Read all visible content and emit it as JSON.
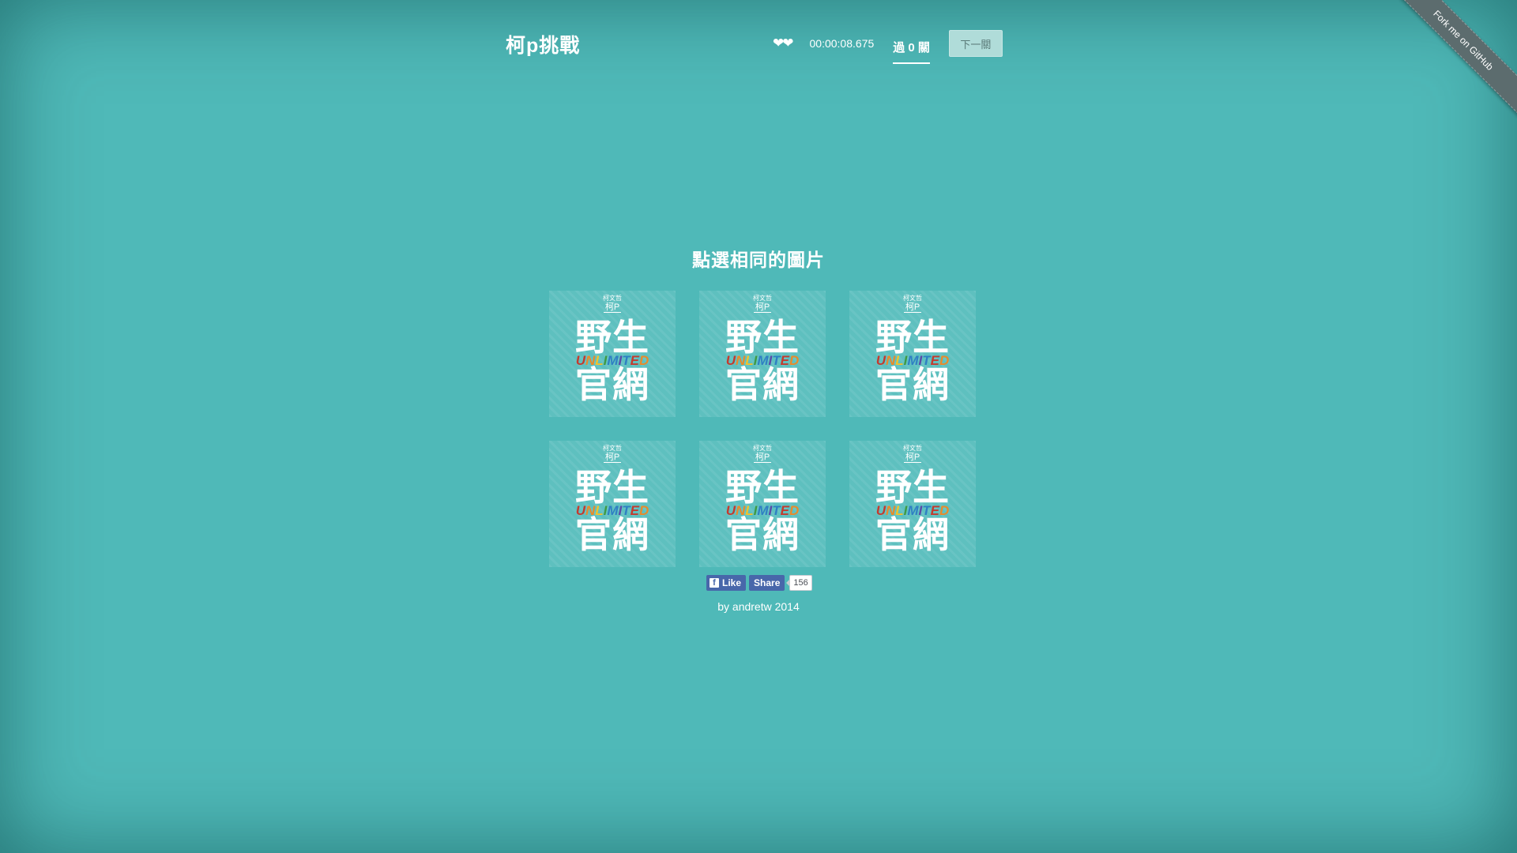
{
  "navbar": {
    "brand": "柯p挑戰",
    "lives": "❤❤",
    "timer": "00:00:08.675",
    "level": "過 0 關",
    "next_button": "下一關"
  },
  "ribbon": {
    "label": "Fork me on GitHub"
  },
  "main": {
    "instruction": "點選相同的圖片",
    "cards": [
      {
        "small": "柯文哲",
        "mark": "柯P",
        "top": "野生",
        "bottom": "官網",
        "stripe": "UNLIMITED"
      },
      {
        "small": "柯文哲",
        "mark": "柯P",
        "top": "野生",
        "bottom": "官網",
        "stripe": "UNLIMITED"
      },
      {
        "small": "柯文哲",
        "mark": "柯P",
        "top": "野生",
        "bottom": "官網",
        "stripe": "UNLIMITED"
      },
      {
        "small": "柯文哲",
        "mark": "柯P",
        "top": "野生",
        "bottom": "官網",
        "stripe": "UNLIMITED"
      },
      {
        "small": "柯文哲",
        "mark": "柯P",
        "top": "野生",
        "bottom": "官網",
        "stripe": "UNLIMITED"
      },
      {
        "small": "柯文哲",
        "mark": "柯P",
        "top": "野生",
        "bottom": "官網",
        "stripe": "UNLIMITED"
      }
    ],
    "stripe_colors": [
      "#c43a2f",
      "#e98a2a",
      "#f2c22c",
      "#3f9a45",
      "#2f7fc4",
      "#5b4aa8",
      "#2f7fc4",
      "#c43a2f",
      "#e98a2a"
    ]
  },
  "social": {
    "like_label": "Like",
    "share_label": "Share",
    "count": "156"
  },
  "footer": {
    "credit": "by andretw 2014"
  },
  "colors": {
    "background": "#4fb9b8",
    "facebook": "#4867aa",
    "ribbon": "#5c6c6e"
  }
}
